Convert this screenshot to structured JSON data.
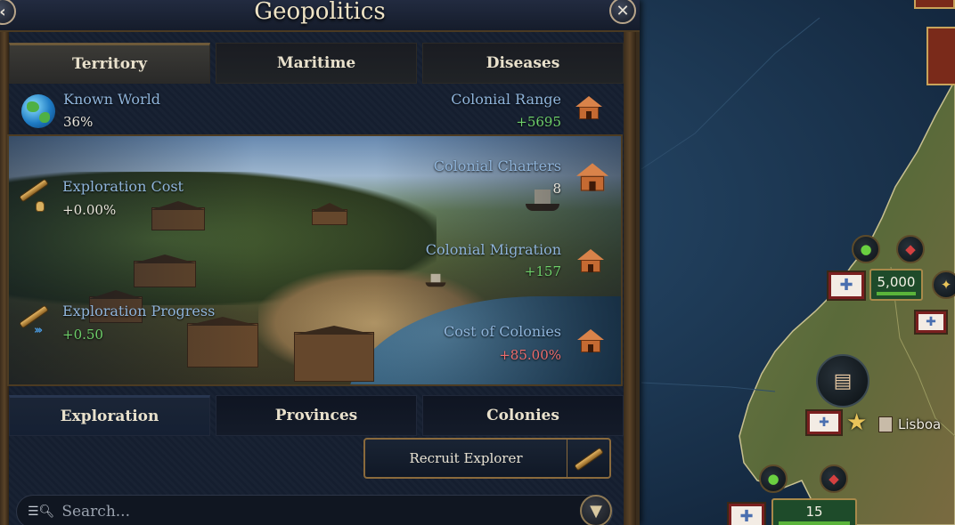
{
  "window": {
    "title": "Geopolitics"
  },
  "top_tabs": [
    {
      "label": "Territory",
      "active": true
    },
    {
      "label": "Maritime",
      "active": false
    },
    {
      "label": "Diseases",
      "active": false
    }
  ],
  "summary": {
    "known_world": {
      "label": "Known World",
      "value": "36%",
      "icon": "globe-icon"
    },
    "colonial_range": {
      "label": "Colonial Range",
      "value": "+5695",
      "icon": "house-range-icon"
    }
  },
  "scene": {
    "exploration_cost": {
      "label": "Exploration Cost",
      "value": "+0.00%",
      "icon": "spyglass-icon"
    },
    "exploration_progress": {
      "label": "Exploration Progress",
      "value": "+0.50",
      "icon": "spyglass-progress-icon"
    },
    "colonial_charters": {
      "label": "Colonial Charters",
      "value": "8",
      "icon": "house-icon"
    },
    "colonial_migration": {
      "label": "Colonial Migration",
      "value": "+157",
      "icon": "house-migration-icon"
    },
    "cost_of_colonies": {
      "label": "Cost of Colonies",
      "value": "+85.00%",
      "icon": "house-cost-icon"
    }
  },
  "bottom_tabs": [
    {
      "label": "Exploration",
      "active": true
    },
    {
      "label": "Provinces",
      "active": false
    },
    {
      "label": "Colonies",
      "active": false
    }
  ],
  "actions": {
    "recruit_explorer": "Recruit Explorer"
  },
  "search": {
    "placeholder": "Search...",
    "value": ""
  },
  "map": {
    "city": "Lisboa",
    "army_count_1": "5,000",
    "army_count_2": "15"
  },
  "colors": {
    "label_blue": "#8fb4da",
    "positive_green": "#6ed06a",
    "negative_red": "#ef6d6d",
    "panel_bg": "#151f30",
    "gold_border": "#8a6a3c"
  }
}
